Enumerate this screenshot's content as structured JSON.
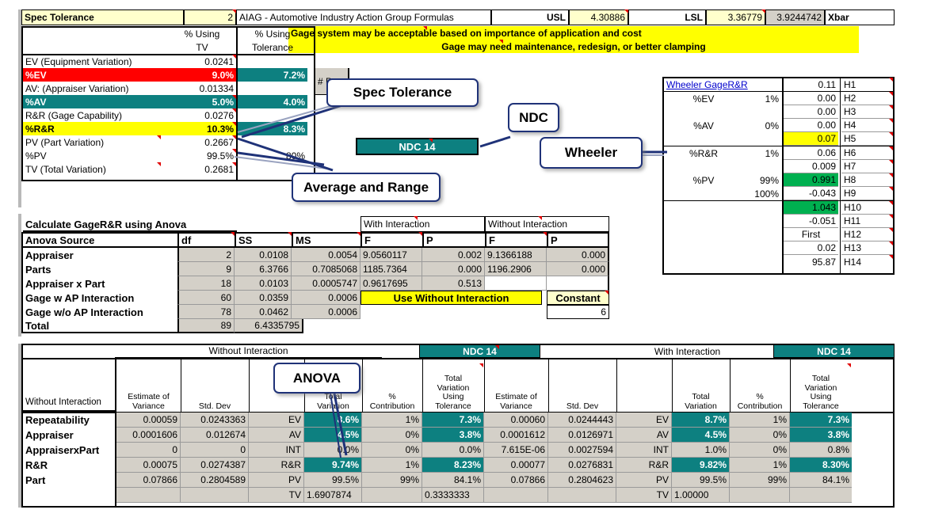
{
  "header": {
    "spec_tolerance_label": "Spec Tolerance",
    "spec_tolerance_value": "2",
    "aiag_text": "AIAG - Automotive Industry Action Group Formulas",
    "usl_label": "USL",
    "usl_value": "4.30886",
    "lsl_label": "LSL",
    "lsl_value": "3.36779",
    "xbar_value": "3.9244742",
    "xbar_label": "Xbar",
    "message_line1": "Gage system may be acceptable based on importance of application and cost",
    "message_line2": "Gage may need maintenance, redesign, or better clamping"
  },
  "left_panel": {
    "col_headers": {
      "pct_tv_line1": "% Using",
      "pct_tv_line2": "TV",
      "pct_tol_line1": "% Using",
      "pct_tol_line2": "Tolerance"
    },
    "rows": [
      {
        "label": "EV (Equipment Variation)",
        "tv": "0.0241",
        "tol": "",
        "style": "plain"
      },
      {
        "label": "%EV",
        "tv": "9.0%",
        "tol": "7.2%",
        "style": "red"
      },
      {
        "label": "AV: (Appraiser Variation)",
        "tv": "0.01334",
        "tol": "",
        "style": "plain"
      },
      {
        "label": "%AV",
        "tv": "5.0%",
        "tol": "4.0%",
        "style": "teal"
      },
      {
        "label": "R&R (Gage Capability)",
        "tv": "0.0276",
        "tol": "",
        "style": "plain"
      },
      {
        "label": "%R&R",
        "tv": "10.3%",
        "tol": "8.3%",
        "style": "yellow"
      },
      {
        "label": "PV (Part Variation)",
        "tv": "0.2667",
        "tol": "",
        "style": "plain"
      },
      {
        "label": "%PV",
        "tv": "99.5%",
        "tol": "80%",
        "style": "plain"
      },
      {
        "label": "TV (Total Variation)",
        "tv": "0.2681",
        "tol": "",
        "style": "plain"
      }
    ],
    "num_parts_label": "# Pa"
  },
  "ndc_banner": "NDC 14",
  "callouts": [
    {
      "name": "spec-tolerance",
      "text": "Spec Tolerance"
    },
    {
      "name": "ndc",
      "text": "NDC"
    },
    {
      "name": "wheeler",
      "text": "Wheeler"
    },
    {
      "name": "average-range",
      "text": "Average and Range"
    },
    {
      "name": "anova",
      "text": "ANOVA"
    }
  ],
  "wheeler": {
    "title": "Wheeler GageR&R",
    "rows": [
      {
        "label": "%EV",
        "pct": "1%",
        "value": "0.11",
        "ref": "H1",
        "fill": "white"
      },
      {
        "label": "%EV",
        "pct": "1%",
        "value": "0.00",
        "ref": "H2",
        "fill": "white"
      },
      {
        "label": "",
        "pct": "",
        "value": "0.00",
        "ref": "H3",
        "fill": "white"
      },
      {
        "label": "%AV",
        "pct": "0%",
        "value": "0.00",
        "ref": "H4",
        "fill": "white"
      },
      {
        "label": "",
        "pct": "",
        "value": "0.07",
        "ref": "H5",
        "fill": "yellow"
      },
      {
        "label": "%R&R",
        "pct": "1%",
        "value": "0.06",
        "ref": "H6",
        "fill": "white"
      },
      {
        "label": "",
        "pct": "",
        "value": "0.009",
        "ref": "H7",
        "fill": "white"
      },
      {
        "label": "%PV",
        "pct": "99%",
        "value": "0.991",
        "ref": "H8",
        "fill": "green"
      },
      {
        "label": "",
        "pct": "100%",
        "value": "-0.043",
        "ref": "H9",
        "fill": "white"
      },
      {
        "label": "",
        "pct": "",
        "value": "1.043",
        "ref": "H10",
        "fill": "green"
      },
      {
        "label": "",
        "pct": "",
        "value": "-0.051",
        "ref": "H11",
        "fill": "white"
      },
      {
        "label": "",
        "pct": "",
        "value": "First",
        "ref": "H12",
        "fill": "white"
      },
      {
        "label": "",
        "pct": "",
        "value": "0.02",
        "ref": "H13",
        "fill": "white"
      },
      {
        "label": "",
        "pct": "",
        "value": "95.87",
        "ref": "H14",
        "fill": "white"
      }
    ]
  },
  "anova": {
    "title": "Calculate GageR&R using Anova",
    "group_with": "With Interaction",
    "group_without": "Without Interaction",
    "headers": [
      "Anova Source",
      "df",
      "SS",
      "MS",
      "F",
      "P",
      "F",
      "P"
    ],
    "rows": [
      {
        "source": "Appraiser",
        "df": "2",
        "ss": "0.0108",
        "ms": "0.0054",
        "f_with": "9.0560117",
        "p_with": "0.002",
        "f_wo": "9.1366188",
        "p_wo": "0.000"
      },
      {
        "source": "Parts",
        "df": "9",
        "ss": "6.3766",
        "ms": "0.7085068",
        "f_with": "1185.7364",
        "p_with": "0.000",
        "f_wo": "1196.2906",
        "p_wo": "0.000"
      },
      {
        "source": "Appraiser x Part",
        "df": "18",
        "ss": "0.0103",
        "ms": "0.0005747",
        "f_with": "0.9617695",
        "p_with": "0.513",
        "f_wo": "",
        "p_wo": ""
      },
      {
        "source": "Gage w AP Interaction",
        "df": "60",
        "ss": "0.0359",
        "ms": "0.0006",
        "f_with": "",
        "p_with": "",
        "f_wo": "",
        "p_wo": ""
      },
      {
        "source": "Gage w/o AP Interaction",
        "df": "78",
        "ss": "0.0462",
        "ms": "0.0006",
        "f_with": "",
        "p_with": "",
        "f_wo": "",
        "p_wo": ""
      },
      {
        "source": "Total",
        "df": "89",
        "ss": "6.4335795",
        "ms": "",
        "f_with": "",
        "p_with": "",
        "f_wo": "",
        "p_wo": ""
      }
    ],
    "use_without_interaction": "Use Without Interaction",
    "constant_label": "Constant",
    "constant_value": "6"
  },
  "results": {
    "band_without": "Without Interaction",
    "band_with": "With Interaction",
    "ndc_left": "NDC 14",
    "ndc_right": "NDC 14",
    "row_header_label": "Without  Interaction",
    "col_headers": {
      "estimate_variance": [
        "Estimate of",
        "Variance"
      ],
      "std_dev": [
        "Std. Dev"
      ],
      "code": [
        ""
      ],
      "total_variation": [
        "Total",
        "Variation"
      ],
      "pct_contribution": [
        "%",
        "Contribution"
      ],
      "tv_using_tolerance": [
        "Total",
        "Variation",
        "Using",
        "Tolerance"
      ]
    },
    "rows": [
      {
        "label": "Repeatability",
        "code": "EV",
        "wo": {
          "var": "0.00059",
          "sd": "0.0243363",
          "tv": "8.6%",
          "pc": "1%",
          "tol": "7.3%"
        },
        "wi": {
          "var": "0.00060",
          "sd": "0.0244443",
          "tv": "8.7%",
          "pc": "1%",
          "tol": "7.3%"
        },
        "hl": [
          "tv",
          "tol"
        ]
      },
      {
        "label": "Appraiser",
        "code": "AV",
        "wo": {
          "var": "0.0001606",
          "sd": "0.012674",
          "tv": "4.5%",
          "pc": "0%",
          "tol": "3.8%"
        },
        "wi": {
          "var": "0.0001612",
          "sd": "0.0126971",
          "tv": "4.5%",
          "pc": "0%",
          "tol": "3.8%"
        },
        "hl": [
          "tv",
          "tol"
        ]
      },
      {
        "label": "AppraiserxPart",
        "code": "INT",
        "wo": {
          "var": "0",
          "sd": "0",
          "tv": "0.0%",
          "pc": "0%",
          "tol": "0.0%"
        },
        "wi": {
          "var": "7.615E-06",
          "sd": "0.0027594",
          "tv": "1.0%",
          "pc": "0%",
          "tol": "0.8%"
        },
        "hl": []
      },
      {
        "label": "R&R",
        "code": "R&R",
        "wo": {
          "var": "0.00075",
          "sd": "0.0274387",
          "tv": "9.74%",
          "pc": "1%",
          "tol": "8.23%"
        },
        "wi": {
          "var": "0.00077",
          "sd": "0.0276831",
          "tv": "9.82%",
          "pc": "1%",
          "tol": "8.30%"
        },
        "hl": [
          "tv",
          "tol"
        ]
      },
      {
        "label": "Part",
        "code": "PV",
        "wo": {
          "var": "0.07866",
          "sd": "0.2804589",
          "tv": "99.5%",
          "pc": "99%",
          "tol": "84.1%"
        },
        "wi": {
          "var": "0.07866",
          "sd": "0.2804623",
          "tv": "99.5%",
          "pc": "99%",
          "tol": "84.1%"
        },
        "hl": []
      },
      {
        "label": "",
        "code": "TV",
        "wo": {
          "var": "",
          "sd": "",
          "tv": "1.6907874",
          "pc": "",
          "tol": "0.3333333"
        },
        "wi": {
          "var": "",
          "sd": "",
          "tv": "1.00000",
          "pc": "",
          "tol": ""
        },
        "hl": []
      }
    ]
  },
  "colors": {
    "teal": "#0d8080",
    "yellow": "#ffff00",
    "red": "#ff0000",
    "green": "#00b050",
    "gray": "#d4d0c8",
    "callout_border": "#1f3278"
  }
}
